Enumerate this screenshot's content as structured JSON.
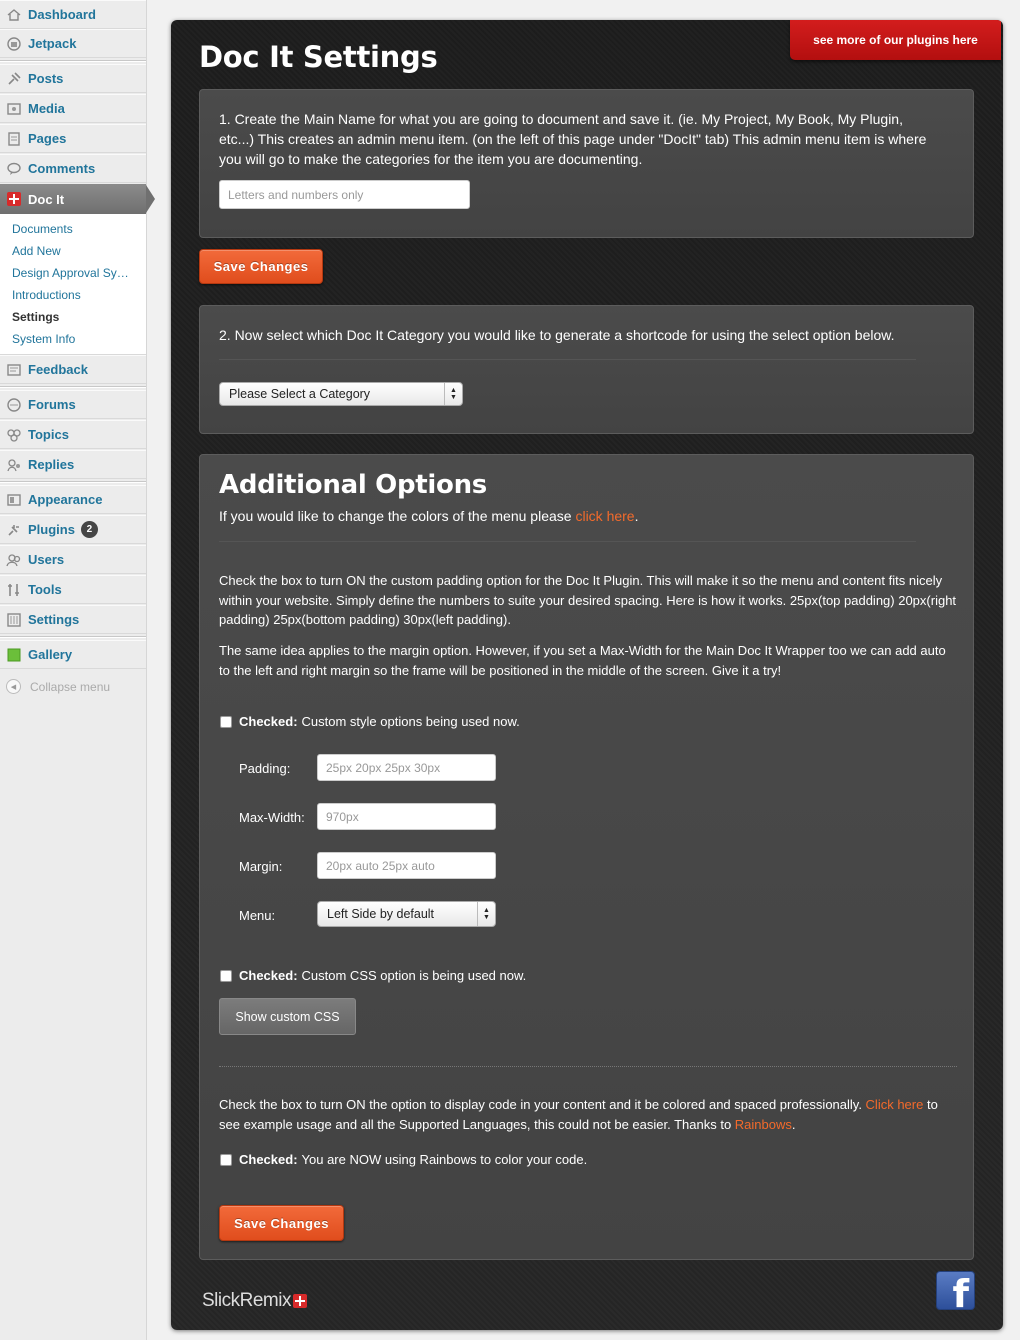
{
  "sidebar": {
    "items": [
      {
        "label": "Dashboard",
        "icon": "dashboard-icon"
      },
      {
        "label": "Jetpack",
        "icon": "jetpack-icon"
      },
      {
        "label": "Posts",
        "icon": "pin-icon"
      },
      {
        "label": "Media",
        "icon": "media-icon"
      },
      {
        "label": "Pages",
        "icon": "pages-icon"
      },
      {
        "label": "Comments",
        "icon": "comments-icon"
      },
      {
        "label": "Doc It",
        "icon": "docit-cross-icon"
      },
      {
        "label": "Feedback",
        "icon": "feedback-icon"
      },
      {
        "label": "Forums",
        "icon": "forums-icon"
      },
      {
        "label": "Topics",
        "icon": "topics-icon"
      },
      {
        "label": "Replies",
        "icon": "replies-icon"
      },
      {
        "label": "Appearance",
        "icon": "appearance-icon"
      },
      {
        "label": "Plugins",
        "icon": "plugins-icon",
        "badge": "2"
      },
      {
        "label": "Users",
        "icon": "users-icon"
      },
      {
        "label": "Tools",
        "icon": "tools-icon"
      },
      {
        "label": "Settings",
        "icon": "settings-icon"
      },
      {
        "label": "Gallery",
        "icon": "gallery-icon"
      }
    ],
    "docit_submenu": [
      {
        "label": "Documents"
      },
      {
        "label": "Add New"
      },
      {
        "label": "Design Approval Sy…"
      },
      {
        "label": "Introductions"
      },
      {
        "label": "Settings",
        "current": true
      },
      {
        "label": "System Info"
      }
    ],
    "collapse_label": "Collapse menu"
  },
  "header": {
    "title": "Doc It Settings",
    "plugins_link": "see more of our plugins here"
  },
  "step1": {
    "text": "1. Create the Main Name for what you are going to document and save it. (ie. My Project, My Book, My Plugin, etc...) This creates an admin menu item. (on the left of this page under \"DocIt\" tab) This admin menu item is where you will go to make the categories for the item you are documenting.",
    "placeholder": "Letters and numbers only",
    "save_label": "Save Changes"
  },
  "step2": {
    "text": "2. Now select which Doc It Category you would like to generate a shortcode for using the select option below.",
    "select_value": "Please Select a Category"
  },
  "additional": {
    "title": "Additional Options",
    "intro_prefix": "If you would like to change the colors of the menu please ",
    "intro_link": "click here",
    "intro_suffix": ".",
    "padding_desc": "Check the box to turn ON the custom padding option for the Doc It Plugin. This will make it so the menu and content fits nicely within your website. Simply define the numbers to suite your desired spacing. Here is how it works. 25px(top padding) 20px(right padding) 25px(bottom padding) 30px(left padding).",
    "margin_desc": "The same idea applies to the margin option. However, if you set a Max-Width for the Main Doc It Wrapper too we can add auto to the left and right margin so the frame will be positioned in the middle of the screen. Give it a try!",
    "custom_style": {
      "checked_label": "Checked:",
      "text": "Custom style options being used now."
    },
    "fields": {
      "padding": {
        "label": "Padding:",
        "placeholder": "25px 20px 25px 30px"
      },
      "max_width": {
        "label": "Max-Width:",
        "placeholder": "970px"
      },
      "margin": {
        "label": "Margin:",
        "placeholder": "20px auto 25px auto"
      },
      "menu": {
        "label": "Menu:",
        "value": "Left Side by default"
      }
    },
    "custom_css": {
      "checked_label": "Checked:",
      "text": "Custom CSS option is being used now.",
      "button": "Show custom CSS"
    },
    "rainbows_desc_1": "Check the box to turn ON the option to display code in your content and it be colored and spaced professionally. ",
    "rainbows_link1": "Click here",
    "rainbows_desc_2": " to see example usage and all the Supported Languages, this could not be easier. Thanks to ",
    "rainbows_link2": "Rainbows",
    "rainbows_desc_3": ".",
    "rainbows": {
      "checked_label": "Checked:",
      "text": "You are NOW using Rainbows to color your code."
    },
    "save_label": "Save Changes"
  },
  "footer": {
    "logo_text": "SlickRemix",
    "facebook_glyph": "f"
  }
}
